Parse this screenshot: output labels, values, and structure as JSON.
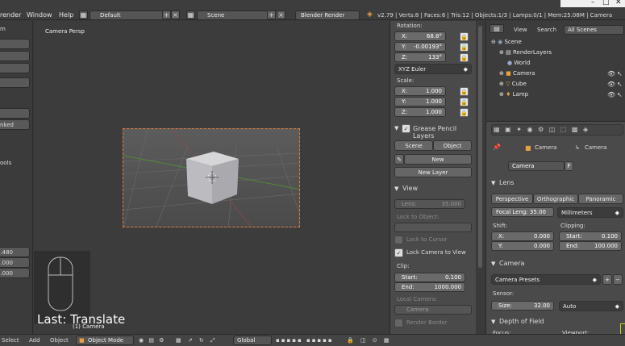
{
  "topbar": {
    "menu": [
      "render",
      "Window",
      "Help"
    ],
    "layout": "Default",
    "scene": "Scene",
    "engine": "Blender Render",
    "stats": "v2.79 | Verts:8 | Faces:6 | Tris:12 | Objects:1/3 | Lamps:0/1 | Mem:25.08M | Camera"
  },
  "leftshelf": {
    "labels": [
      "m",
      "nked",
      "ools"
    ],
    "values": [
      ".480",
      ".000",
      ".000"
    ]
  },
  "viewport": {
    "title": "Camera Persp",
    "operator": "Last: Translate",
    "object_label": "(1) Camera"
  },
  "npanel": {
    "rotation_label": "Rotation:",
    "rotation": [
      {
        "axis": "X:",
        "value": "68.8°"
      },
      {
        "axis": "Y:",
        "value": "-0.00193°"
      },
      {
        "axis": "Z:",
        "value": "133°"
      }
    ],
    "rotation_mode": "XYZ Euler",
    "scale_label": "Scale:",
    "scale": [
      {
        "axis": "X:",
        "value": "1.000"
      },
      {
        "axis": "Y:",
        "value": "1.000"
      },
      {
        "axis": "Z:",
        "value": "1.000"
      }
    ],
    "gp_title": "Grease Pencil Layers",
    "gp_tabs": [
      "Scene",
      "Object"
    ],
    "gp_new": "New",
    "gp_new_layer": "New Layer",
    "view_title": "View",
    "lens_label": "Lens:",
    "lens_value": "35.000",
    "lock_object": "Lock to Object:",
    "lock_cursor": "Lock to Cursor",
    "lock_camera": "Lock Camera to View",
    "clip_label": "Clip:",
    "clip_start_label": "Start:",
    "clip_start": "0.100",
    "clip_end_label": "End:",
    "clip_end": "1000.000",
    "local_camera": "Local Camera:",
    "local_camera_value": "Camera",
    "render_border": "Render Border"
  },
  "outliner": {
    "view": "View",
    "search": "Search",
    "filter": "All Scenes",
    "items": [
      "Scene",
      "RenderLayers",
      "World",
      "Camera",
      "Cube",
      "Lamp"
    ]
  },
  "props": {
    "breadcrumb": [
      "Camera",
      "Camera"
    ],
    "datablock": "Camera",
    "datablock_flag": "F",
    "lens_title": "Lens",
    "lens_tabs": [
      "Perspective",
      "Orthographic",
      "Panoramic"
    ],
    "focal_length": "Focal Leng: 35.00",
    "lens_unit": "Millimeters",
    "shift_label": "Shift:",
    "shift": [
      {
        "axis": "X:",
        "value": "0.000"
      },
      {
        "axis": "Y:",
        "value": "0.000"
      }
    ],
    "clipping_label": "Clipping:",
    "clip_start_label": "Start:",
    "clip_start": "0.100",
    "clip_end_label": "End:",
    "clip_end": "100.000",
    "camera_title": "Camera",
    "camera_presets": "Camera Presets",
    "sensor_label": "Sensor:",
    "size_label": "Size:",
    "size_value": "32.00",
    "sensor_fit": "Auto",
    "dof_title": "Depth of Field",
    "focus_label": "Focus:",
    "viewport_label": "Viewport:"
  },
  "bottombar": {
    "items": [
      "Select",
      "Add",
      "Object"
    ],
    "mode": "Object Mode",
    "orientation": "Global"
  }
}
